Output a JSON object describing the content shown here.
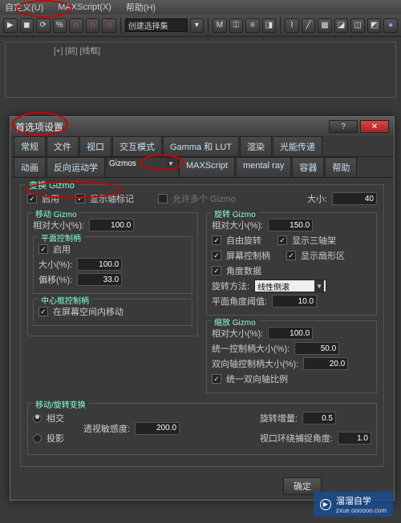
{
  "menus": {
    "customize": "自定义(U)",
    "maxscript": "MAXScript(X)",
    "help": "帮助(H)"
  },
  "toolbar": {
    "select_set": "创建选择集"
  },
  "viewport": {
    "label": "[+] [前] [线框]"
  },
  "dialog": {
    "title": "首选项设置",
    "tabs_row1": [
      "常规",
      "文件",
      "视口",
      "交互模式",
      "Gamma 和 LUT",
      "渲染",
      "光能传递"
    ],
    "tabs_row2": [
      "动画",
      "反向运动学",
      "Gizmos",
      "MAXScript",
      "mental ray",
      "容器",
      "帮助"
    ],
    "active_tab": "Gizmos",
    "ok": "确定"
  },
  "transform_gizmo": {
    "legend": "变换 Gizmo",
    "enable": "启用",
    "show_axis": "显示轴标记",
    "allow_multi": "允许多个 Gizmo",
    "size_label": "大小:",
    "size_value": "40"
  },
  "move_gizmo": {
    "legend": "移动 Gizmo",
    "relative_size": "相对大小(%):",
    "relative_size_val": "100.0",
    "plane_handles_legend": "平面控制柄",
    "plane_enable": "启用",
    "plane_size": "大小(%):",
    "plane_size_val": "100.0",
    "plane_offset": "偏移(%):",
    "plane_offset_val": "33.0",
    "center_box_legend": "中心框控制柄",
    "center_move": "在屏幕空间内移动"
  },
  "rotate_gizmo": {
    "legend": "旋转 Gizmo",
    "relative_size": "相对大小(%):",
    "relative_size_val": "150.0",
    "free_rotate": "自由旋转",
    "show_tripod": "显示三轴架",
    "screen_handle": "屏幕控制柄",
    "show_pie": "显示扇形区",
    "angle_data": "角度数据",
    "method": "旋转方法:",
    "method_val": "线性侧滚",
    "planar_thresh": "平面角度阈值:",
    "planar_thresh_val": "10.0"
  },
  "scale_gizmo": {
    "legend": "缩放 Gizmo",
    "relative_size": "相对大小(%):",
    "relative_size_val": "100.0",
    "uniform2": "统一控制柄大小(%):",
    "uniform2_val": "50.0",
    "biaxial": "双向轴控制柄大小(%):",
    "biaxial_val": "20.0",
    "uniform_ratio": "统一双向轴比例"
  },
  "move_rotate_transform": {
    "legend": "移动/旋转变换",
    "intersect": "相交",
    "project": "投影",
    "persp_sens": "透视敏感度:",
    "persp_sens_val": "200.0",
    "rotate_incr": "旋转增量:",
    "rotate_incr_val": "0.5",
    "viewport_arc": "视口环绕捕捉角度:",
    "viewport_arc_val": "1.0"
  },
  "watermark": {
    "text": "溜溜自学",
    "sub": "zxue.oooooo.com"
  }
}
